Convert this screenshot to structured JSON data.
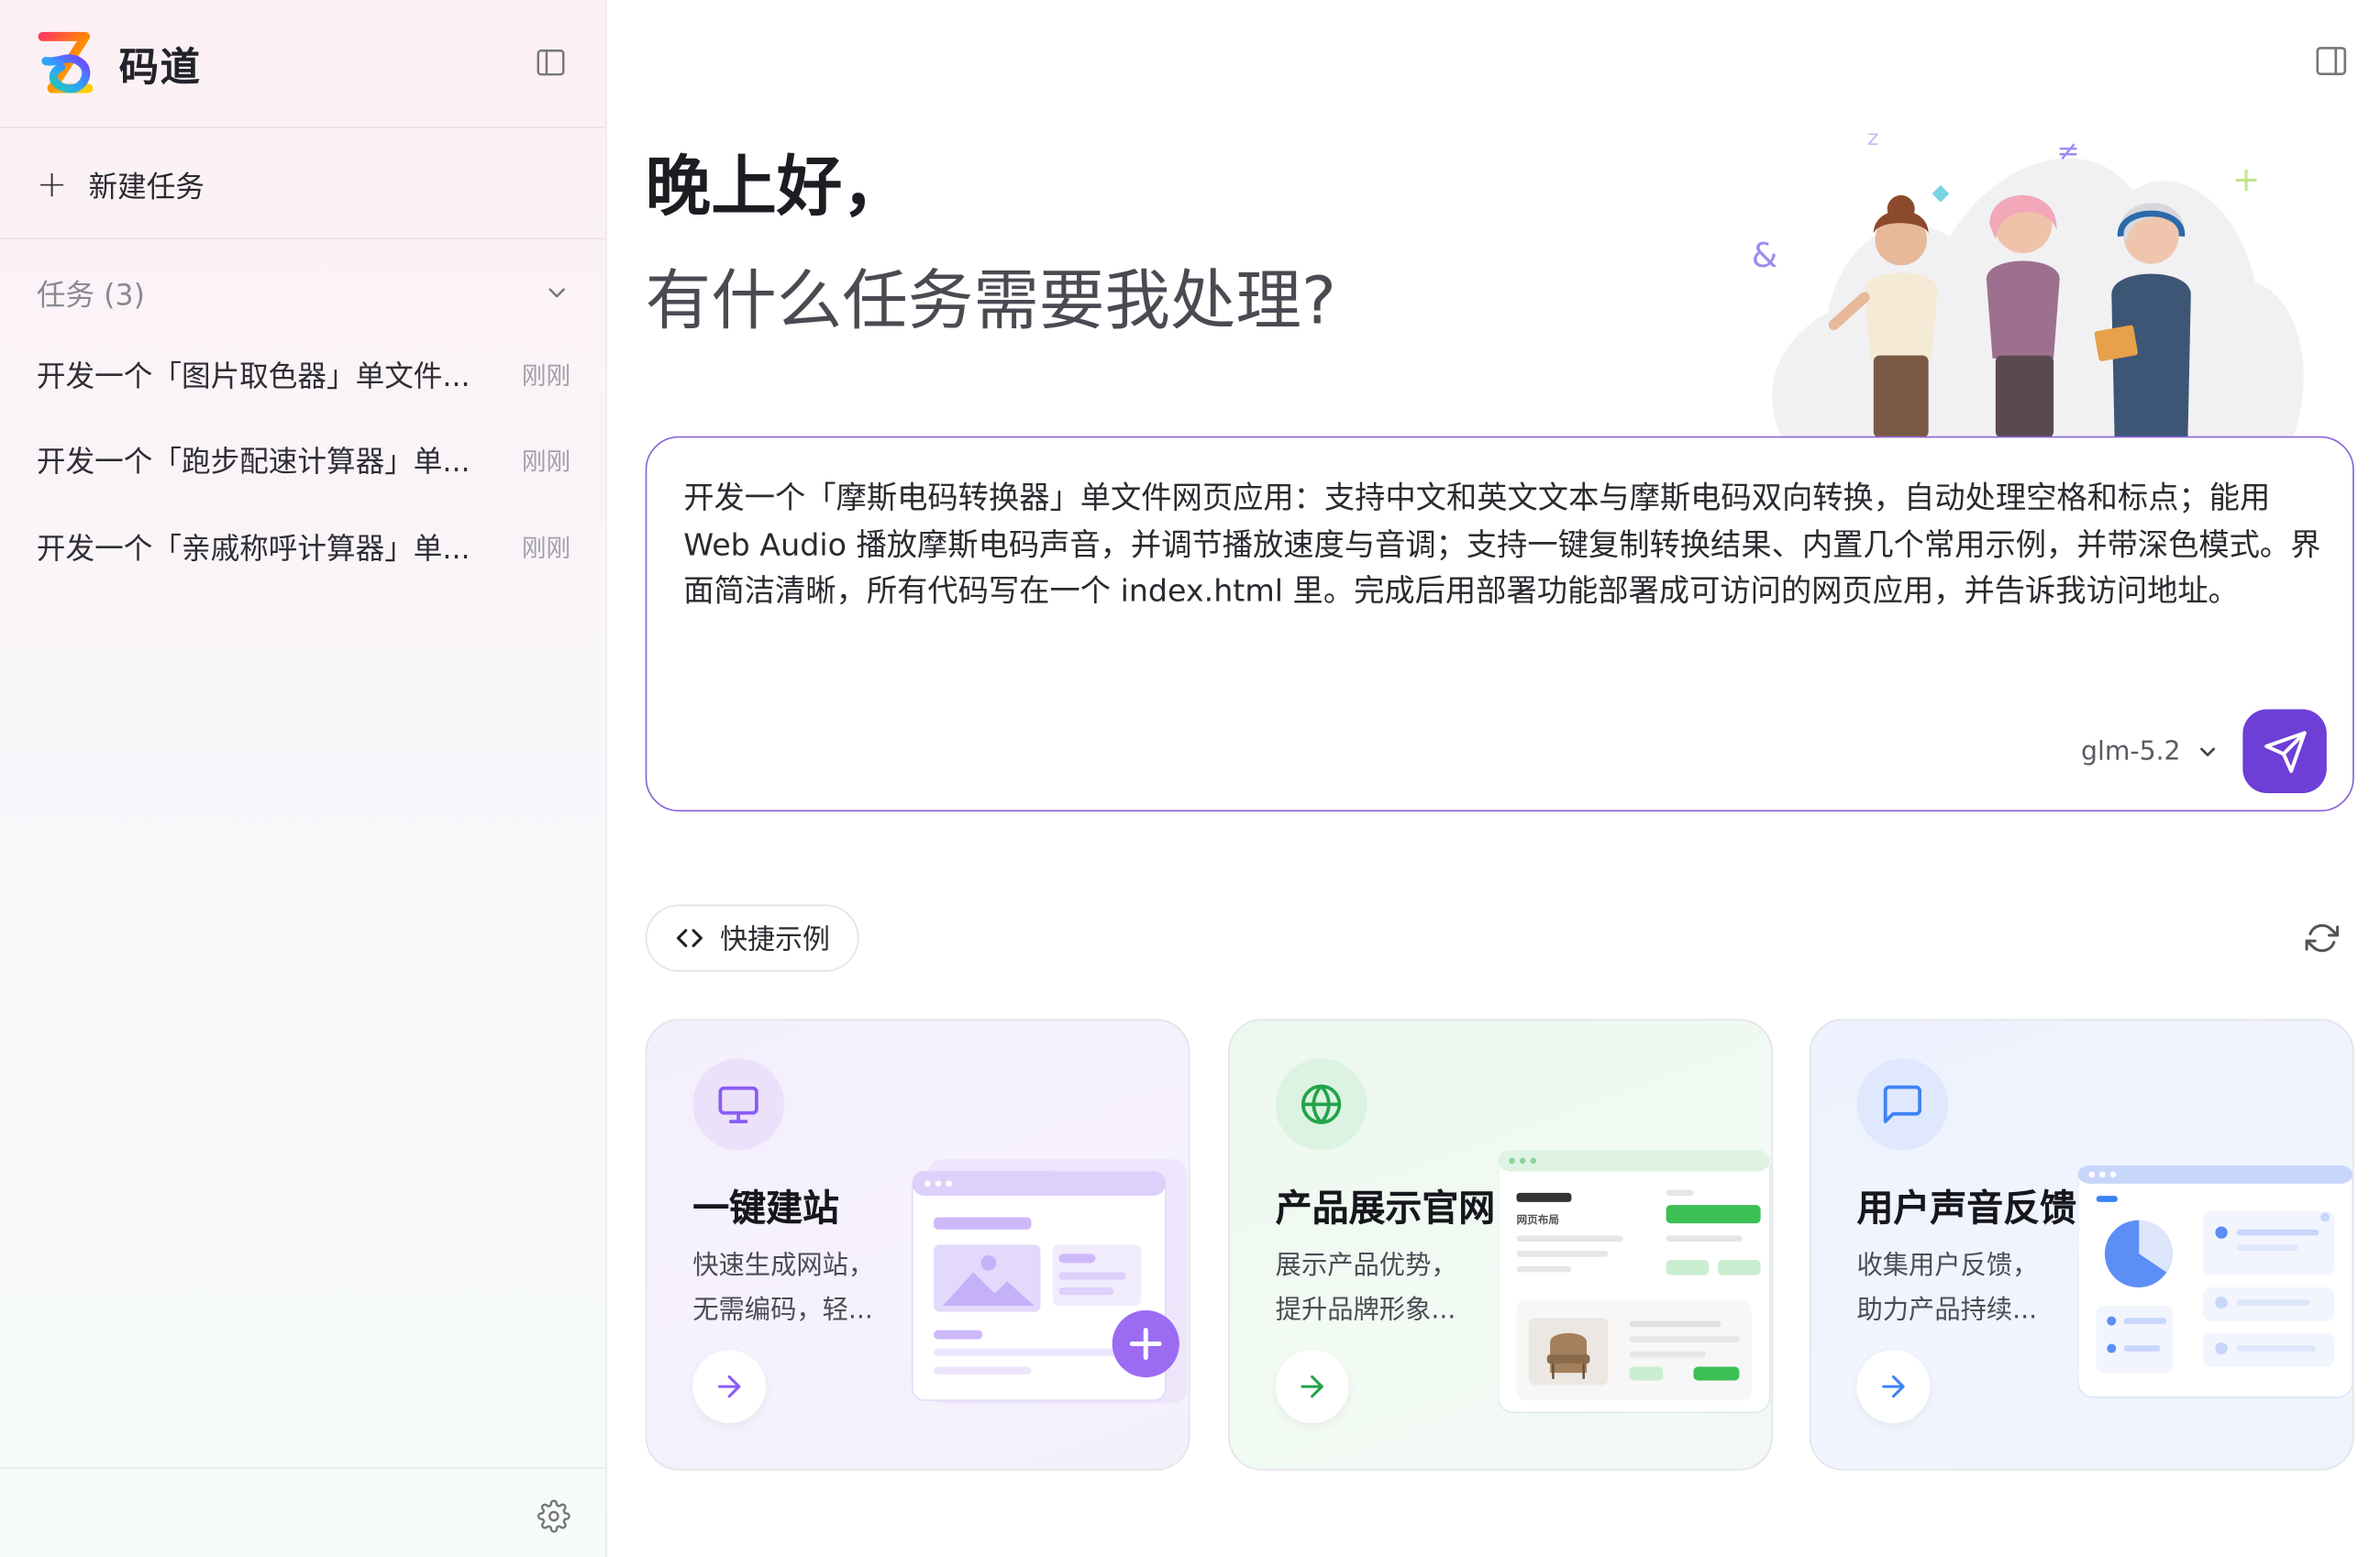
{
  "app": {
    "name": "码道"
  },
  "sidebar": {
    "new_task_label": "新建任务",
    "tasks_header": "任务 (3)",
    "tasks": [
      {
        "title": "开发一个「图片取色器」单文件...",
        "time": "刚刚"
      },
      {
        "title": "开发一个「跑步配速计算器」单...",
        "time": "刚刚"
      },
      {
        "title": "开发一个「亲戚称呼计算器」单...",
        "time": "刚刚"
      }
    ]
  },
  "main": {
    "greeting_line1": "晚上好，",
    "greeting_line2": "有什么任务需要我处理?",
    "prompt": {
      "text": "开发一个「摩斯电码转换器」单文件网页应用：支持中文和英文文本与摩斯电码双向转换，自动处理空格和标点；能用 Web Audio 播放摩斯电码声音，并调节播放速度与音调；支持一键复制转换结果、内置几个常用示例，并带深色模式。界面简洁清晰，所有代码写在一个 index.html 里。完成后用部署功能部署成可访问的网页应用，并告诉我访问地址。",
      "model": "glm-5.2"
    },
    "quick_examples_label": "快捷示例",
    "cards": [
      {
        "title": "一键建站",
        "desc_line1": "快速生成网站，",
        "desc_line2": "无需编码，轻...",
        "icon": "monitor-icon",
        "accent": "#8b5cf6"
      },
      {
        "title": "产品展示官网",
        "desc_line1": "展示产品优势，",
        "desc_line2": "提升品牌形象...",
        "icon": "globe-icon",
        "accent": "#22a34a",
        "illus_label": "网页布局"
      },
      {
        "title": "用户声音反馈",
        "desc_line1": "收集用户反馈，",
        "desc_line2": "助力产品持续...",
        "icon": "message-square-icon",
        "accent": "#3b82f6"
      }
    ]
  }
}
